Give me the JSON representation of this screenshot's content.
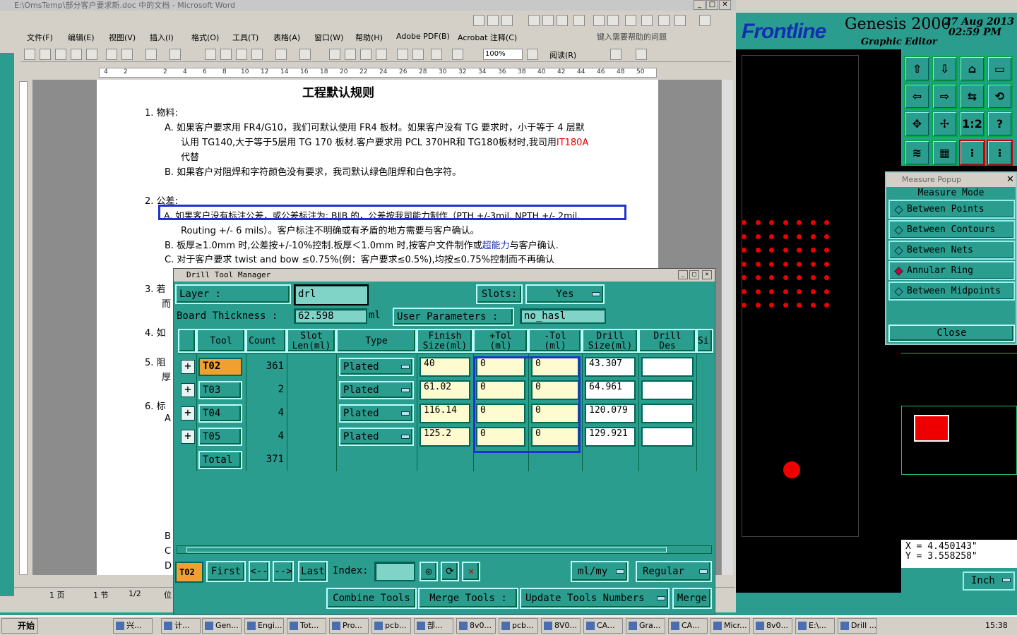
{
  "word": {
    "title": "E:\\OmsTemp\\部分客户要求新.doc 中的文档 - Microsoft Word",
    "menu": [
      "文件(F)",
      "编辑(E)",
      "视图(V)",
      "插入(I)",
      "格式(O)",
      "工具(T)",
      "表格(A)",
      "窗口(W)",
      "帮助(H)",
      "Adobe PDF(B)",
      "Acrobat 注释(C)"
    ],
    "help_placeholder": "键入需要帮助的问题",
    "zoom": "100%",
    "reading_label": "阅读(R)",
    "ruler_numbers": [
      "4",
      "2",
      "2",
      "4",
      "6",
      "8",
      "10",
      "12",
      "14",
      "16",
      "18",
      "20",
      "22",
      "24",
      "26",
      "28",
      "30",
      "32",
      "34",
      "36",
      "38",
      "40",
      "42",
      "44",
      "46",
      "48",
      "50"
    ],
    "doc": {
      "heading": "工程默认规则",
      "l1": "1.   物料:",
      "l2a": "A.   如果客户要求用 FR4/G10，我们可默认使用 FR4 板材。如果客户没有 TG 要求时，小于等于 4 层默",
      "l2b": "认用 TG140,大于等于5层用 TG 170 板材.客户要求用 PCL 370HR和 TG180板材时,我司用",
      "l2b_red": "IT180A",
      "l2c": "代替",
      "l3": "B.   如果客户对阻焊和字符颜色没有要求，我司默认绿色阻焊和白色字符。",
      "l4": "2.   公差:",
      "l5a": "A.   如果客户没有标注公差，或公差标注为: B∥B 的，公差按我司能力制作（PTH +/-3mil. NPTH +/- 2mil.",
      "l5b": "Routing +/- 6 mils）。客户标注不明确或有矛盾的地方需要与客户确认。",
      "l6a": "B.   板厚≥1.0mm 时,公差按+/-10%控制.板厚＜1.0mm 时,按客户文件制作或",
      "l6b_blue": "超能力",
      "l6c": "与客户确认.",
      "l7": "C.   对于客户要求 twist and bow  ≤0.75%(例：客户要求≤0.5%),均按≤0.75%控制而不再确认",
      "l8": "3.   若",
      "l8b": "而",
      "l9": "4.   如",
      "l10": "5.   阻",
      "l10b": "厚",
      "l11": "6.   标",
      "l11b": "A",
      "lB": "B",
      "lC": "C",
      "lD": "D"
    },
    "status": {
      "page": "1 页",
      "section": "1 节",
      "pos": "1/2",
      "at": "位"
    }
  },
  "genesis": {
    "logo": "Frontline",
    "title": "Genesis 2000",
    "date": "27 Aug 2013",
    "time": "02:59 PM",
    "subtitle": "Graphic Editor",
    "icon_labels": [
      "1:2",
      "?"
    ],
    "coord_x": "X = 4.450143\"",
    "coord_y": "Y = 3.558258\"",
    "units": "Inch"
  },
  "measure": {
    "title": "Measure Popup",
    "mode_label": "Measure Mode",
    "items": [
      "Between Points",
      "Between Contours",
      "Between Nets",
      "Annular Ring",
      "Between Midpoints"
    ],
    "selected_index": 3,
    "close": "Close"
  },
  "dtm": {
    "title": "Drill Tool Manager",
    "layer_label": "Layer            :",
    "layer_value": "drl",
    "slots_label": "Slots:",
    "slots_value": "Yes",
    "thickness_label": "Board Thickness :",
    "thickness_value": "62.598",
    "thickness_unit": "ml",
    "user_params_label": "User Parameters :",
    "user_params_value": "no_hasl",
    "headers": {
      "tool": "Tool",
      "count": "Count",
      "slot": "Slot\nLen(ml)",
      "type": "Type",
      "finish": "Finish\nSize(ml)",
      "ptol": "+Tol\n(ml)",
      "mtol": "-Tol\n(ml)",
      "drill": "Drill\nSize(ml)",
      "des": "Drill\nDes",
      "si": "Si"
    },
    "rows": [
      {
        "tool": "T02",
        "count": "361",
        "type": "Plated",
        "finish": "40",
        "ptol": "0",
        "mtol": "0",
        "drill": "43.307"
      },
      {
        "tool": "T03",
        "count": "2",
        "type": "Plated",
        "finish": "61.02",
        "ptol": "0",
        "mtol": "0",
        "drill": "64.961"
      },
      {
        "tool": "T04",
        "count": "4",
        "type": "Plated",
        "finish": "116.14",
        "ptol": "0",
        "mtol": "0",
        "drill": "120.079"
      },
      {
        "tool": "T05",
        "count": "4",
        "type": "Plated",
        "finish": "125.2",
        "ptol": "0",
        "mtol": "0",
        "drill": "129.921"
      }
    ],
    "total_label": "Total",
    "total_value": "371",
    "current_tool": "T02",
    "nav": {
      "first": "First",
      "prev": "<--",
      "next": "-->",
      "last": "Last",
      "index": "Index:"
    },
    "units_select": "ml/my",
    "mode_select": "Regular",
    "buttons": {
      "combine": "Combine Tools",
      "merge_label": "Merge Tools :",
      "update": "Update Tools Numbers",
      "merge": "Merge"
    }
  },
  "taskbar": {
    "start": "开始",
    "tasks": [
      "兴...",
      "计...",
      "Gen...",
      "Engi...",
      "Tot...",
      "Pro...",
      "pcb...",
      "部...",
      "8v0...",
      "pcb...",
      "8V0...",
      "CA...",
      "Gra...",
      "CA...",
      "Micr...",
      "8v0...",
      "E:\\...",
      "Drill ..."
    ],
    "clock": "15:38"
  }
}
